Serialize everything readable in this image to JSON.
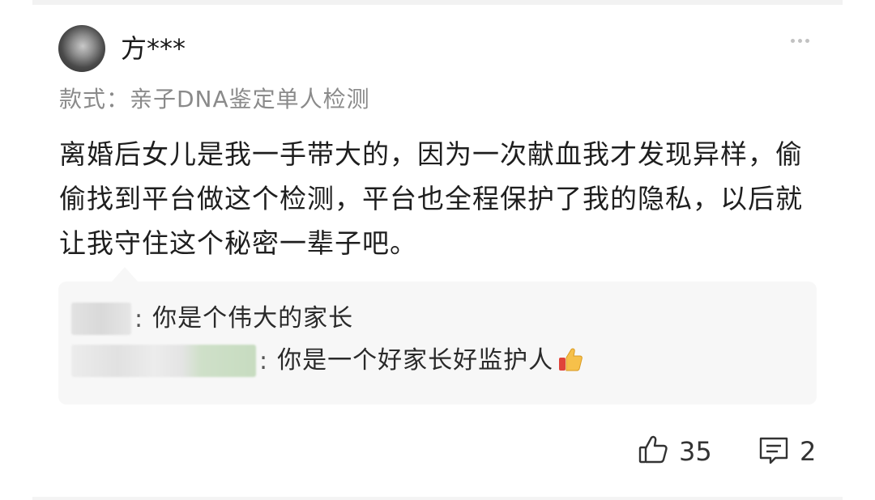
{
  "review": {
    "username": "方***",
    "variant": "款式：亲子DNA鉴定单人检测",
    "text": "离婚后女儿是我一手带大的，因为一次献血我才发现异样，偷偷找到平台做这个检测，平台也全程保护了我的隐私，以后就让我守住这个秘密一辈子吧。"
  },
  "replies": [
    {
      "separator": ":",
      "text": "你是个伟大的家长"
    },
    {
      "separator": ":",
      "text": "你是一个好家长好监护人"
    }
  ],
  "actions": {
    "like_count": "35",
    "comment_count": "2"
  },
  "icons": {
    "more": "more-dots-icon",
    "like": "thumbs-up-icon",
    "comment": "comment-icon",
    "emoji": "thumbs-up-emoji-icon"
  },
  "colors": {
    "reply_background": "#f7f7f7",
    "secondary_text": "#8a8a8a"
  }
}
